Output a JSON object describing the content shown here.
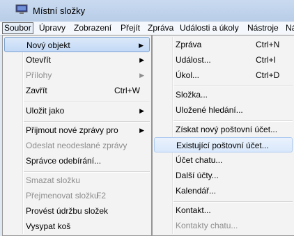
{
  "window": {
    "title": "Místní složky"
  },
  "menubar": [
    "Soubor",
    "Úpravy",
    "Zobrazení",
    "Přejít",
    "Zpráva",
    "Události a úkoly",
    "Nástroje",
    "Ná"
  ],
  "file_menu": [
    {
      "label": "Nový objekt",
      "submenu": true,
      "hl": true
    },
    {
      "label": "Otevřít",
      "submenu": true
    },
    {
      "label": "Přílohy",
      "submenu": true,
      "disabled": true
    },
    {
      "label": "Zavřít",
      "shortcut": "Ctrl+W"
    },
    {
      "label": "Uložit jako",
      "submenu": true
    },
    {
      "label": "Přijmout nové zprávy pro",
      "submenu": true
    },
    {
      "label": "Odeslat neodeslané zprávy",
      "disabled": true
    },
    {
      "label": "Správce odebírání..."
    },
    {
      "label": "Smazat složku",
      "disabled": true
    },
    {
      "label": "Přejmenovat složku...",
      "shortcut": "F2",
      "disabled": true
    },
    {
      "label": "Provést údržbu složek"
    },
    {
      "label": "Vysypat koš"
    }
  ],
  "new_submenu": [
    {
      "label": "Zpráva",
      "shortcut": "Ctrl+N"
    },
    {
      "label": "Událost...",
      "shortcut": "Ctrl+I"
    },
    {
      "label": "Úkol...",
      "shortcut": "Ctrl+D"
    },
    {
      "label": "Složka..."
    },
    {
      "label": "Uložené hledání..."
    },
    {
      "label": "Získat nový poštovní účet..."
    },
    {
      "label": "Existující poštovní účet...",
      "hl": true
    },
    {
      "label": "Účet chatu..."
    },
    {
      "label": "Další účty..."
    },
    {
      "label": "Kalendář..."
    },
    {
      "label": "Kontakt..."
    },
    {
      "label": "Kontakty chatu...",
      "disabled": true
    }
  ]
}
